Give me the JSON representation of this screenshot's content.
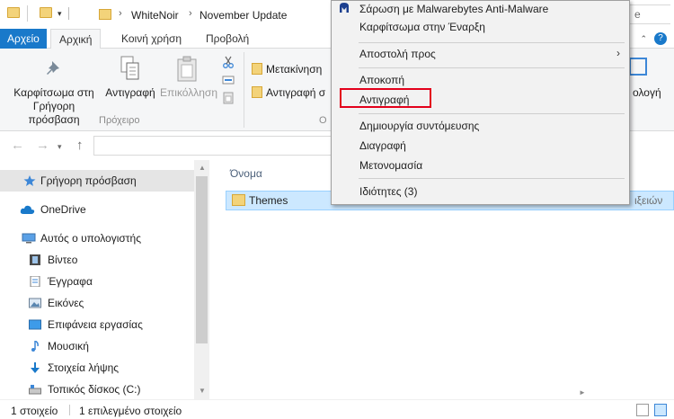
{
  "ribbon_tabs": {
    "file": "Αρχείο",
    "home": "Αρχική",
    "share": "Κοινή χρήση",
    "view": "Προβολή"
  },
  "ribbon": {
    "pin_label_1": "Καρφίτσωμα στη",
    "pin_label_2": "Γρήγορη πρόσβαση",
    "copy_label": "Αντιγραφή",
    "paste_label": "Επικόλληση",
    "move_label": "Μετακίνηση",
    "copyto_label": "Αντιγραφή σ",
    "clipboard_group": "Πρόχειρο",
    "organize_group_partial": "Ο",
    "layout_partial": "ολογή"
  },
  "address": {
    "crumbs": [
      "WhiteNoir",
      "November Update"
    ],
    "search_partial": "e"
  },
  "nav": {
    "quick_access": "Γρήγορη πρόσβαση",
    "onedrive": "OneDrive",
    "this_pc": "Αυτός ο υπολογιστής",
    "videos": "Βίντεο",
    "documents": "Έγγραφα",
    "pictures": "Εικόνες",
    "desktop": "Επιφάνεια εργασίας",
    "music": "Μουσική",
    "downloads": "Στοιχεία λήψης",
    "local_disk": "Τοπικός δίσκος (C:)"
  },
  "content": {
    "column_name": "Όνομα",
    "files": [
      {
        "name": "Themes",
        "type_partial": "ιξειών"
      }
    ]
  },
  "status": {
    "items": "1 στοιχείο",
    "selected": "1 επιλεγμένο στοιχείο"
  },
  "context_menu": {
    "items": [
      "Σάρωση με Malwarebytes Anti-Malware",
      "Καρφίτσωμα στην Έναρξη",
      "Αποστολή προς",
      "Αποκοπή",
      "Αντιγραφή",
      "Δημιουργία συντόμευσης",
      "Διαγραφή",
      "Μετονομασία",
      "Ιδιότητες (3)"
    ],
    "submenu_arrow": "›"
  },
  "colors": {
    "accent": "#1979ca",
    "selection": "#cce8ff",
    "highlight_box": "#e3001b"
  }
}
